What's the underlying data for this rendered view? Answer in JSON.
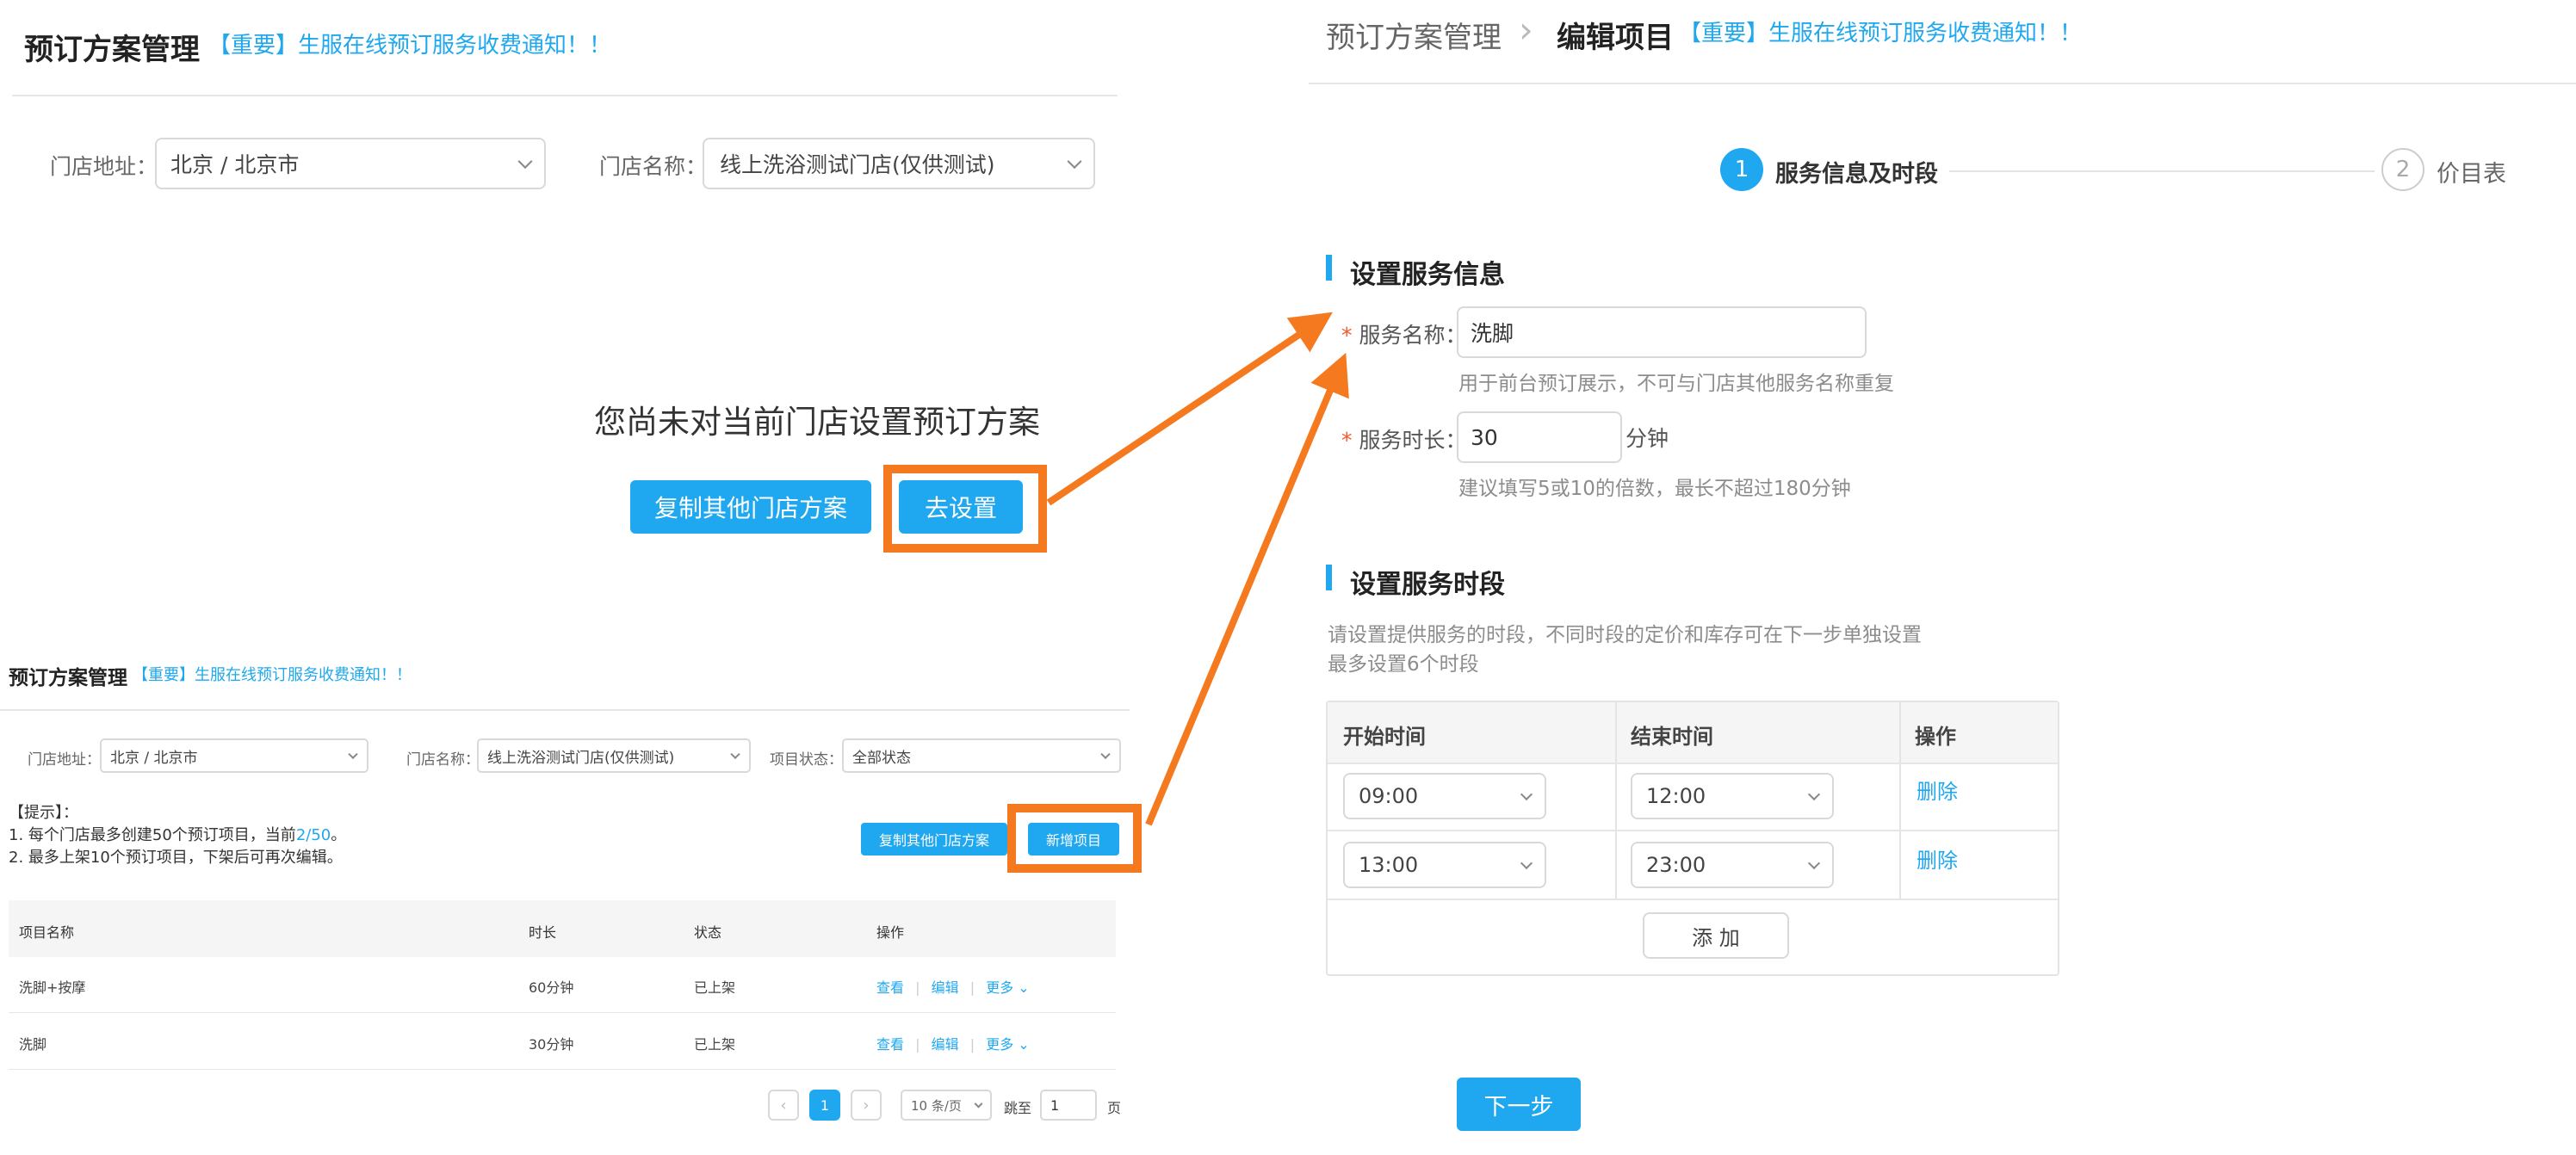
{
  "left_top": {
    "title": "预订方案管理",
    "notice": "【重要】生服在线预订服务收费通知！！",
    "addr_label": "门店地址：",
    "addr_value": "北京 / 北京市",
    "store_label": "门店名称：",
    "store_value": "线上洗浴测试门店(仅供测试)",
    "empty_msg": "您尚未对当前门店设置预订方案",
    "copy_btn": "复制其他门店方案",
    "setup_btn": "去设置"
  },
  "left_bottom": {
    "title": "预订方案管理",
    "notice": "【重要】生服在线预订服务收费通知！！",
    "addr_label": "门店地址：",
    "addr_value": "北京 / 北京市",
    "store_label": "门店名称：",
    "store_value": "线上洗浴测试门店(仅供测试)",
    "status_label": "项目状态：",
    "status_value": "全部状态",
    "tip_title": "【提示】：",
    "tip1_prefix": "1. 每个门店最多创建50个预订项目，当前",
    "tip1_count": "2/50",
    "tip1_suffix": "。",
    "tip2": "2. 最多上架10个预订项目，下架后可再次编辑。",
    "copy_btn": "复制其他门店方案",
    "add_btn": "新增项目",
    "columns": [
      "项目名称",
      "时长",
      "状态",
      "操作"
    ],
    "rows": [
      {
        "name": "洗脚+按摩",
        "duration": "60分钟",
        "status": "已上架"
      },
      {
        "name": "洗脚",
        "duration": "30分钟",
        "status": "已上架"
      }
    ],
    "actions": {
      "view": "查看",
      "edit": "编辑",
      "more": "更多"
    },
    "pager": {
      "prev": "‹",
      "current": "1",
      "next": "›",
      "size": "10 条/页",
      "jump_label": "跳至",
      "jump_value": "1",
      "page_unit": "页"
    }
  },
  "right": {
    "breadcrumb_parent": "预订方案管理",
    "breadcrumb_sep": "›",
    "page_title": "编辑项目",
    "notice": "【重要】生服在线预订服务收费通知！！",
    "steps": [
      {
        "num": "1",
        "label": "服务信息及时段"
      },
      {
        "num": "2",
        "label": "价目表"
      }
    ],
    "section1": "设置服务信息",
    "req_mark": "*",
    "name_label": "服务名称：",
    "name_value": "洗脚",
    "name_help": "用于前台预订展示，不可与门店其他服务名称重复",
    "dur_label": "服务时长：",
    "dur_value": "30",
    "dur_unit": "分钟",
    "dur_help": "建议填写5或10的倍数，最长不超过180分钟",
    "section2": "设置服务时段",
    "slot_help1": "请设置提供服务的时段，不同时段的定价和库存可在下一步单独设置",
    "slot_help2": "最多设置6个时段",
    "columns": [
      "开始时间",
      "结束时间",
      "操作"
    ],
    "slots": [
      {
        "start": "09:00",
        "end": "12:00",
        "action": "删除"
      },
      {
        "start": "13:00",
        "end": "23:00",
        "action": "删除"
      }
    ],
    "add_btn": "添 加",
    "next_btn": "下一步"
  },
  "colors": {
    "accent": "#1fa8ef",
    "highlight": "#f5791e",
    "required": "#f5562b"
  }
}
